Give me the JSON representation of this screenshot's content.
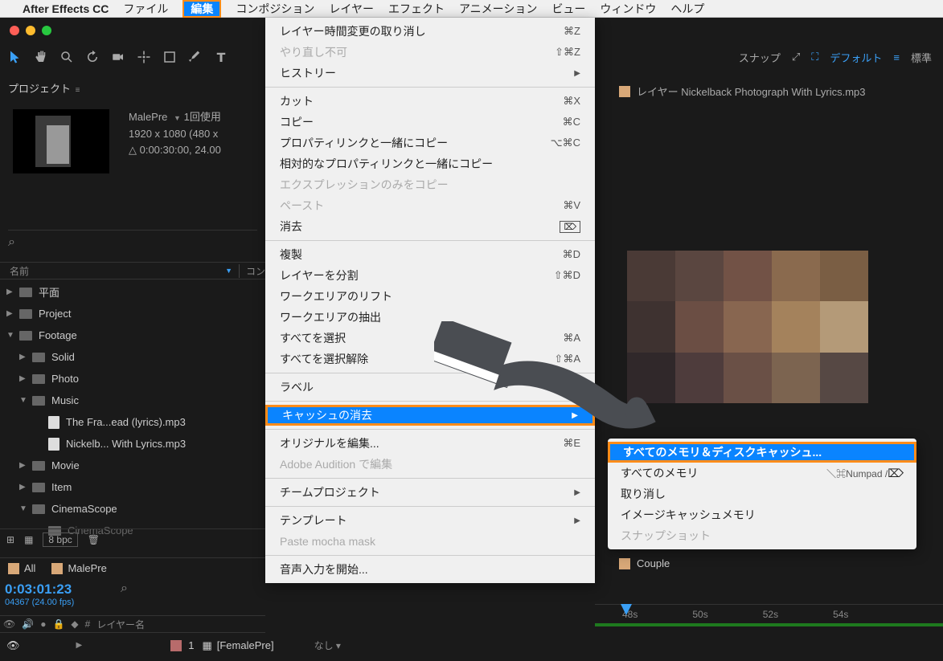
{
  "menubar": {
    "appname": "After Effects CC",
    "items": [
      "ファイル",
      "編集",
      "コンポジション",
      "レイヤー",
      "エフェクト",
      "アニメーション",
      "ビュー",
      "ウィンドウ",
      "ヘルプ"
    ],
    "active_index": 1
  },
  "toolbar_right": {
    "snap": "スナップ",
    "workspace": "デフォルト",
    "mode": "標準"
  },
  "project_panel_title": "プロジェクト",
  "comp_info": {
    "name": "MalePre",
    "usage": "1回使用",
    "dims": "1920 x 1080  (480 x",
    "duration": "△ 0:00:30:00, 24.00"
  },
  "col_name": "名前",
  "col_comment_abbrev": "コン",
  "tree": [
    {
      "d": "▶",
      "ind": 0,
      "t": "folder",
      "label": "平面"
    },
    {
      "d": "▶",
      "ind": 0,
      "t": "folder",
      "label": "Project"
    },
    {
      "d": "▼",
      "ind": 0,
      "t": "folder",
      "label": "Footage"
    },
    {
      "d": "▶",
      "ind": 1,
      "t": "folder",
      "label": "Solid"
    },
    {
      "d": "▶",
      "ind": 1,
      "t": "folder",
      "label": "Photo"
    },
    {
      "d": "▼",
      "ind": 1,
      "t": "folder",
      "label": "Music"
    },
    {
      "d": "",
      "ind": 2,
      "t": "file",
      "label": "The Fra...ead (lyrics).mp3"
    },
    {
      "d": "",
      "ind": 2,
      "t": "file",
      "label": "Nickelb... With Lyrics.mp3"
    },
    {
      "d": "▶",
      "ind": 1,
      "t": "folder",
      "label": "Movie"
    },
    {
      "d": "▶",
      "ind": 1,
      "t": "folder",
      "label": "Item"
    },
    {
      "d": "▼",
      "ind": 1,
      "t": "folder",
      "label": "CinemaScope"
    }
  ],
  "tree_cut": "CinemaScope",
  "footer_bpc": "8 bpc",
  "tabs": {
    "all": "All",
    "malepre": "MalePre",
    "couple": "Couple"
  },
  "timecode": {
    "tc": "0:03:01:23",
    "fps": "04367 (24.00 fps)"
  },
  "layer_header": {
    "num": "#",
    "name": "レイヤー名"
  },
  "layer_row": {
    "num": "1",
    "name": "[FemalePre]",
    "mode": "なし"
  },
  "layer_panel_label": "レイヤー Nickelback   Photograph With Lyrics.mp3",
  "ruler": [
    "48s",
    "50s",
    "52s",
    "54s"
  ],
  "edit_menu": [
    {
      "label": "レイヤー時間変更の取り消し",
      "sc": "⌘Z"
    },
    {
      "label": "やり直し不可",
      "sc": "⇧⌘Z",
      "disabled": true
    },
    {
      "label": "ヒストリー",
      "sub": true
    },
    {
      "sep": true
    },
    {
      "label": "カット",
      "sc": "⌘X"
    },
    {
      "label": "コピー",
      "sc": "⌘C"
    },
    {
      "label": "プロパティリンクと一緒にコピー",
      "sc": "⌥⌘C"
    },
    {
      "label": "相対的なプロパティリンクと一緒にコピー"
    },
    {
      "label": "エクスプレッションのみをコピー",
      "disabled": true
    },
    {
      "label": "ペースト",
      "sc": "⌘V",
      "disabled": true
    },
    {
      "label": "消去",
      "del": true
    },
    {
      "sep": true
    },
    {
      "label": "複製",
      "sc": "⌘D"
    },
    {
      "label": "レイヤーを分割",
      "sc": "⇧⌘D"
    },
    {
      "label": "ワークエリアのリフト"
    },
    {
      "label": "ワークエリアの抽出"
    },
    {
      "label": "すべてを選択",
      "sc": "⌘A"
    },
    {
      "label": "すべてを選択解除",
      "sc": "⇧⌘A"
    },
    {
      "sep": true
    },
    {
      "label": "ラベル",
      "sub": true
    },
    {
      "sep": true
    },
    {
      "label": "キャッシュの消去",
      "sub": true,
      "hl": true
    },
    {
      "sep": true
    },
    {
      "label": "オリジナルを編集...",
      "sc": "⌘E"
    },
    {
      "label": "Adobe Audition で編集",
      "disabled": true
    },
    {
      "sep": true
    },
    {
      "label": "チームプロジェクト",
      "sub": true
    },
    {
      "sep": true
    },
    {
      "label": "テンプレート",
      "sub": true
    },
    {
      "label": "Paste mocha mask",
      "disabled": true
    },
    {
      "sep": true
    },
    {
      "label": "音声入力を開始..."
    }
  ],
  "submenu": [
    {
      "label": "すべてのメモリ＆ディスクキャッシュ...",
      "hl": true
    },
    {
      "label": "すべてのメモリ",
      "sc": "＼⌘Numpad /",
      "del": true
    },
    {
      "label": "取り消し"
    },
    {
      "label": "イメージキャッシュメモリ"
    },
    {
      "label": "スナップショット",
      "disabled": true
    }
  ]
}
